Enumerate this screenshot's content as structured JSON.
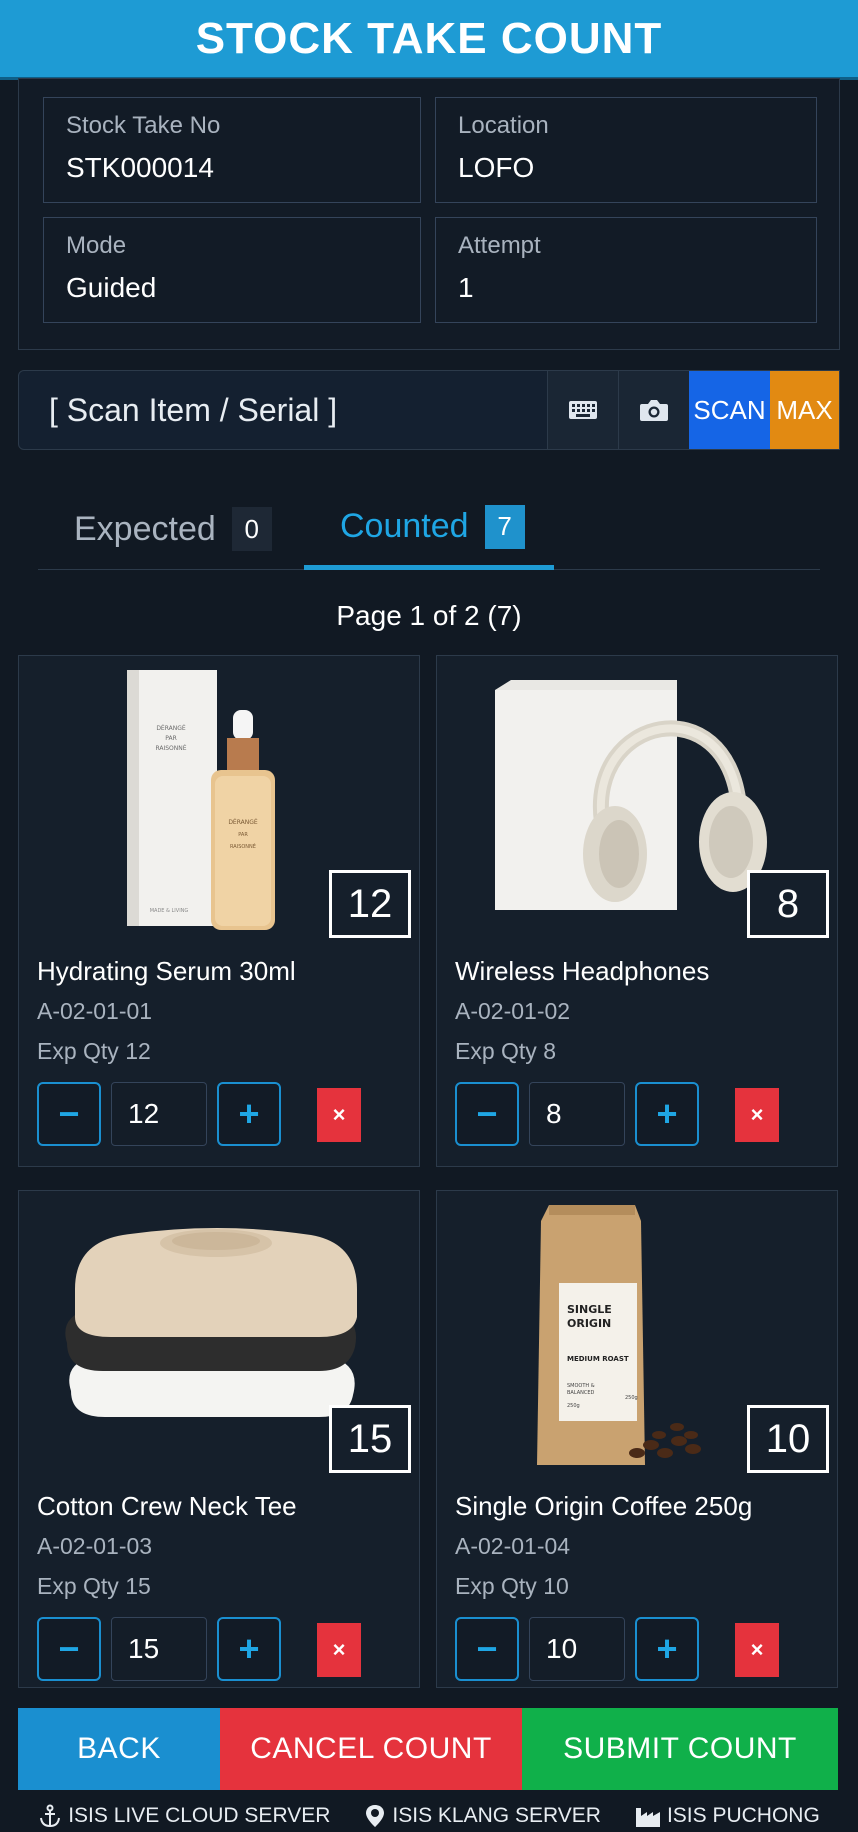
{
  "header": {
    "title": "STOCK TAKE COUNT"
  },
  "info": {
    "stock_take_no": {
      "label": "Stock Take No",
      "value": "STK000014"
    },
    "location": {
      "label": "Location",
      "value": "LOFO"
    },
    "mode": {
      "label": "Mode",
      "value": "Guided"
    },
    "attempt": {
      "label": "Attempt",
      "value": "1"
    }
  },
  "scan": {
    "placeholder": "[ Scan Item / Serial ]",
    "keyboard_icon": "keyboard-icon",
    "camera_icon": "camera-icon",
    "scan_label": "SCAN",
    "max_label": "MAX",
    "colors": {
      "scan": "#1565e6",
      "max": "#e28a12"
    }
  },
  "tabs": [
    {
      "label": "Expected",
      "count": "0",
      "active": false
    },
    {
      "label": "Counted",
      "count": "7",
      "active": true
    }
  ],
  "page_info": "Page 1 of 2 (7)",
  "items": [
    {
      "name": "Hydrating Serum 30ml",
      "location": "A-02-01-01",
      "exp_qty": "Exp Qty 12",
      "counted": "12",
      "qty_value": "12",
      "box_text": [
        "DÉRANGÉ",
        "PAR",
        "RAISONNÉ"
      ],
      "bottle_text": [
        "DÉRANGÉ",
        "PAR",
        "RAISONNÉ"
      ],
      "box_footer": "MADE & LIVING"
    },
    {
      "name": "Wireless Headphones",
      "location": "A-02-01-02",
      "exp_qty": "Exp Qty 8",
      "counted": "8",
      "qty_value": "8"
    },
    {
      "name": "Cotton Crew Neck Tee",
      "location": "A-02-01-03",
      "exp_qty": "Exp Qty 15",
      "counted": "15",
      "qty_value": "15"
    },
    {
      "name": "Single Origin Coffee 250g",
      "location": "A-02-01-04",
      "exp_qty": "Exp Qty 10",
      "counted": "10",
      "qty_value": "10",
      "bag_text": [
        "SINGLE",
        "ORIGIN",
        "MEDIUM ROAST",
        "SMOOTH &",
        "BALANCED",
        "250g",
        "250g"
      ]
    }
  ],
  "controls": {
    "minus": "−",
    "plus": "+",
    "delete": "×"
  },
  "footer": {
    "back": "BACK",
    "cancel": "CANCEL COUNT",
    "submit": "SUBMIT COUNT",
    "colors": {
      "back": "#1a8fd0",
      "cancel": "#e5333d",
      "submit": "#10b04a"
    }
  },
  "status": [
    {
      "icon": "anchor-icon",
      "label": "ISIS LIVE CLOUD SERVER"
    },
    {
      "icon": "location-pin-icon",
      "label": "ISIS KLANG SERVER"
    },
    {
      "icon": "factory-icon",
      "label": "ISIS PUCHONG"
    }
  ]
}
